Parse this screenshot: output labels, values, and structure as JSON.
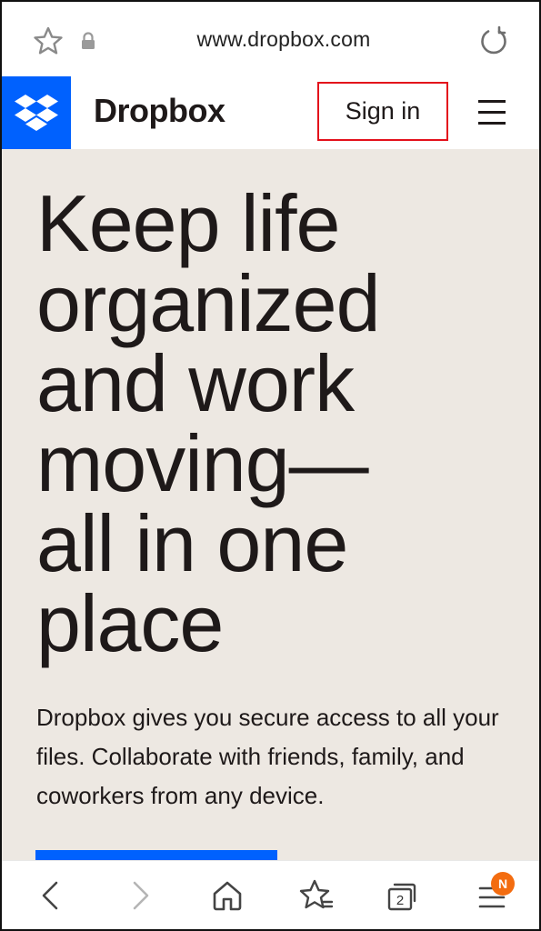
{
  "browser": {
    "url": "www.dropbox.com",
    "icons": [
      "star-icon",
      "lock-icon",
      "reload-icon"
    ]
  },
  "header": {
    "brand_name": "Dropbox",
    "signin_label": "Sign in",
    "icons": [
      "dropbox-logo-icon",
      "hamburger-menu-icon"
    ],
    "colors": {
      "logo_bg": "#0061fe",
      "highlight_border": "#e3101b"
    }
  },
  "hero": {
    "headline_lines": [
      "Keep life",
      "organized",
      "and work",
      "moving—",
      "all in one",
      "place"
    ],
    "subtext": "Dropbox gives you secure access to all your files. Collaborate with friends, family, and coworkers from any device.",
    "colors": {
      "background": "#ede8e2",
      "cta": "#0061fe"
    }
  },
  "bottom_nav": {
    "tab_count": "2",
    "badge_letter": "N",
    "icons": [
      "back-icon",
      "forward-icon",
      "home-icon",
      "bookmarks-icon",
      "tabs-icon",
      "menu-icon"
    ],
    "colors": {
      "badge": "#f36c10"
    }
  }
}
